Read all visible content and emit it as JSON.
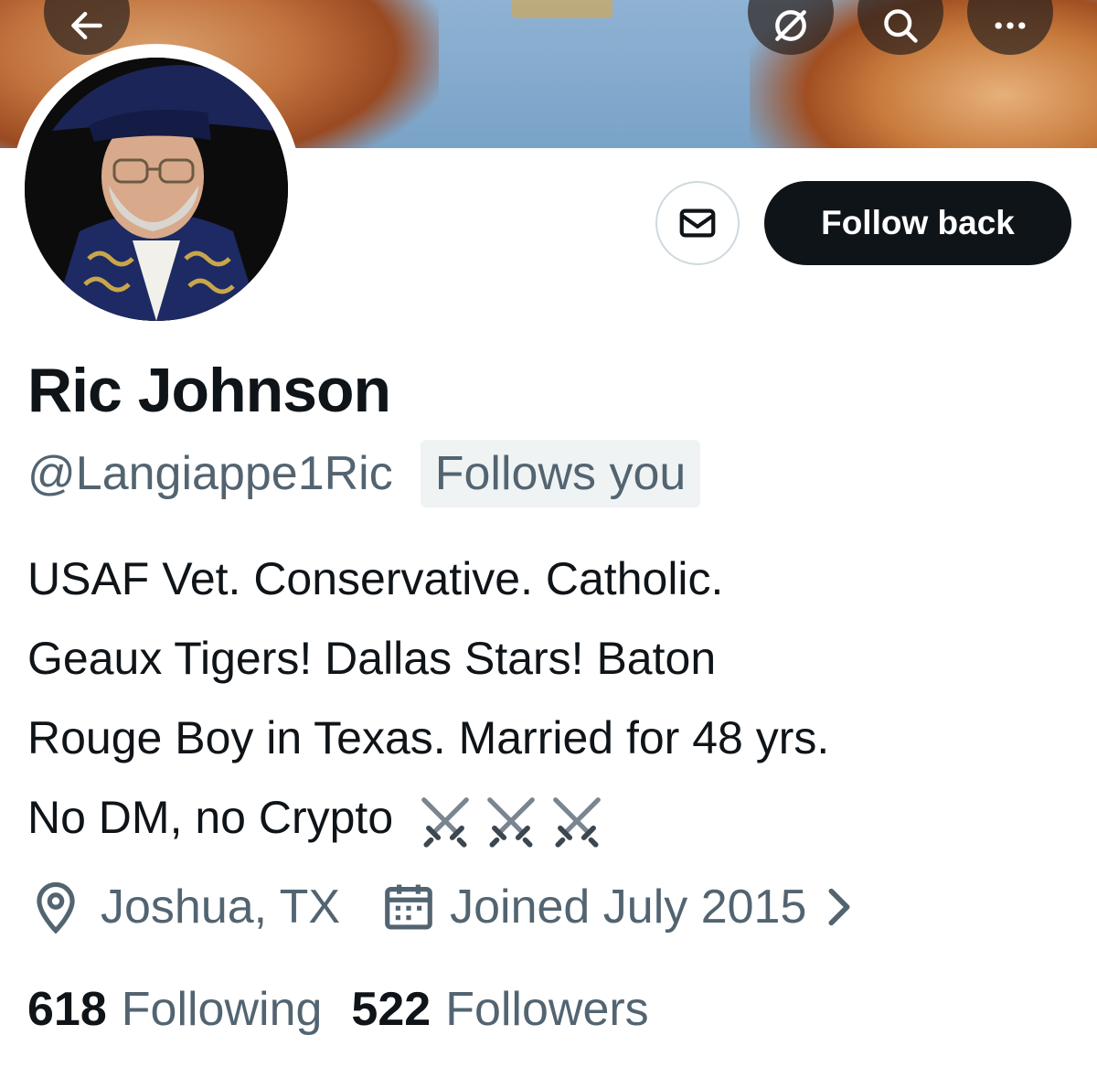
{
  "header": {
    "back_icon": "arrow-left-icon",
    "grok_icon": "grok-slash-icon",
    "search_icon": "search-icon",
    "more_icon": "more-horizontal-icon"
  },
  "profile": {
    "display_name": "Ric Johnson",
    "handle": "@Langiappe1Ric",
    "follows_you_badge": "Follows you",
    "bio_lines": [
      "USAF Vet. Conservative. Catholic.",
      "Geaux Tigers! Dallas Stars! Baton",
      "Rouge Boy in Texas. Married for 48 yrs.",
      "No DM, no Crypto"
    ],
    "bio_emoji": "⚔️⚔️⚔️",
    "location": "Joshua, TX",
    "joined": "Joined July 2015",
    "following_count": "618",
    "following_label": "Following",
    "followers_count": "522",
    "followers_label": "Followers"
  },
  "actions": {
    "message_icon": "envelope-icon",
    "follow_back_label": "Follow back"
  },
  "colors": {
    "primary_text": "#0f1419",
    "secondary_text": "#536471",
    "button_bg": "#0f1419",
    "badge_bg": "#eff3f4"
  }
}
